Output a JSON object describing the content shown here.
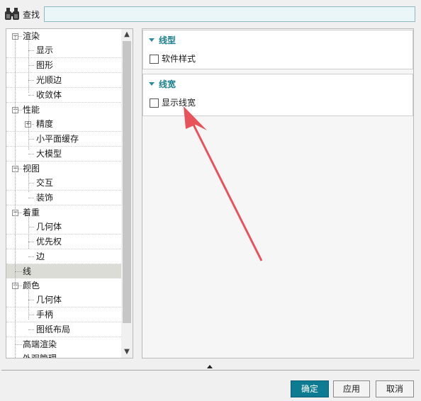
{
  "search": {
    "label": "查找",
    "value": ""
  },
  "tree": {
    "items": [
      {
        "label": "渲染",
        "level": 0,
        "expanded": true
      },
      {
        "label": "显示",
        "level": 1
      },
      {
        "label": "图形",
        "level": 1
      },
      {
        "label": "光顺边",
        "level": 1
      },
      {
        "label": "收敛体",
        "level": 1
      },
      {
        "label": "性能",
        "level": 0,
        "expanded": true
      },
      {
        "label": "精度",
        "level": 1,
        "collapsed": true
      },
      {
        "label": "小平面缓存",
        "level": 1
      },
      {
        "label": "大模型",
        "level": 1
      },
      {
        "label": "视图",
        "level": 0,
        "expanded": true
      },
      {
        "label": "交互",
        "level": 1
      },
      {
        "label": "装饰",
        "level": 1
      },
      {
        "label": "着重",
        "level": 0,
        "expanded": true
      },
      {
        "label": "几何体",
        "level": 1
      },
      {
        "label": "优先权",
        "level": 1
      },
      {
        "label": "边",
        "level": 1
      },
      {
        "label": "线",
        "level": 0,
        "selected": true
      },
      {
        "label": "颜色",
        "level": 0,
        "expanded": true
      },
      {
        "label": "几何体",
        "level": 1
      },
      {
        "label": "手柄",
        "level": 1
      },
      {
        "label": "图纸布局",
        "level": 1
      },
      {
        "label": "高端渲染",
        "level": 0
      },
      {
        "label": "外观管理",
        "level": 0
      }
    ]
  },
  "sections": [
    {
      "title": "线型",
      "checkbox_label": "软件样式",
      "checked": false
    },
    {
      "title": "线宽",
      "checkbox_label": "显示线宽",
      "checked": false
    }
  ],
  "buttons": {
    "ok": "确定",
    "apply": "应用",
    "cancel": "取消"
  },
  "colors": {
    "accent": "#1a7f8e",
    "primary_button": "#0d7b92",
    "annotation_arrow": "#e8525a"
  },
  "icons": {
    "search": "binoculars-icon",
    "scroll_up": "chevron-up-icon",
    "scroll_down": "chevron-down-icon",
    "collapse": "caret-up-icon"
  }
}
